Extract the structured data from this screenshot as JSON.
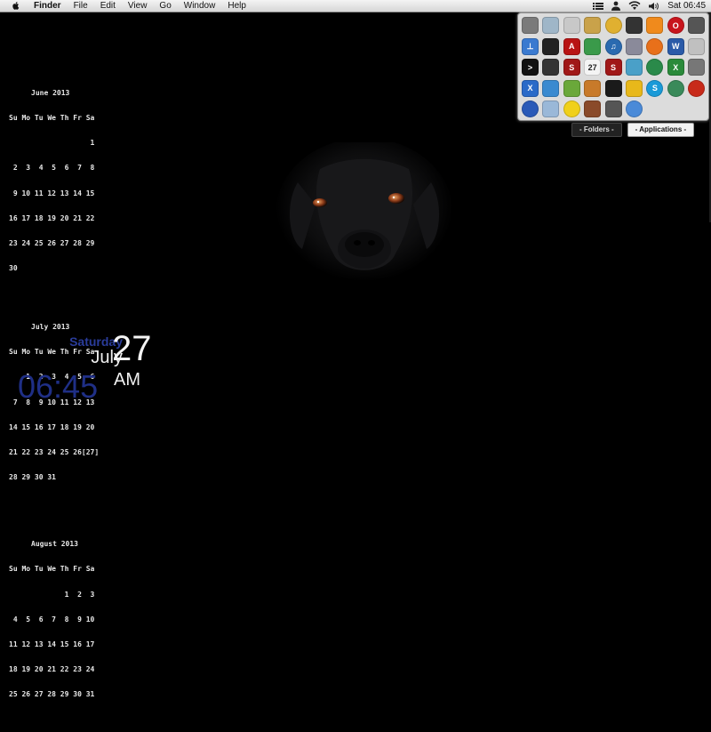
{
  "menubar": {
    "app_name": "Finder",
    "menus": [
      "File",
      "Edit",
      "View",
      "Go",
      "Window",
      "Help"
    ],
    "status_icons": [
      "list-icon",
      "user-icon",
      "wifi-icon",
      "volume-icon"
    ],
    "clock": "Sat 06:45"
  },
  "calendars": [
    {
      "title": "June 2013",
      "header": "Su Mo Tu We Th Fr Sa",
      "weeks": [
        "                   1",
        " 2  3  4  5  6  7  8",
        " 9 10 11 12 13 14 15",
        "16 17 18 19 20 21 22",
        "23 24 25 26 27 28 29",
        "30"
      ]
    },
    {
      "title": "July 2013",
      "header": "Su Mo Tu We Th Fr Sa",
      "weeks": [
        "    1  2  3  4  5  6",
        " 7  8  9 10 11 12 13",
        "14 15 16 17 18 19 20",
        "21 22 23 24 25 26[27]",
        "28 29 30 31"
      ]
    },
    {
      "title": "August 2013",
      "header": "Su Mo Tu We Th Fr Sa",
      "weeks": [
        "             1  2  3",
        " 4  5  6  7  8  9 10",
        "11 12 13 14 15 16 17",
        "18 19 20 21 22 23 24",
        "25 26 27 28 29 30 31"
      ]
    }
  ],
  "dateclock": {
    "weekday": "Saturday",
    "month": "July",
    "day": "27",
    "time": "06:45",
    "ampm": "AM"
  },
  "stack": {
    "tabs": {
      "folders": "- Folders -",
      "applications": "- Applications -"
    },
    "icons": [
      {
        "name": "utility-icon",
        "color": "#7a7a7a",
        "glyph": ""
      },
      {
        "name": "mail-icon",
        "color": "#9fb6c8",
        "glyph": ""
      },
      {
        "name": "archive-icon",
        "color": "#c8c8c8",
        "glyph": ""
      },
      {
        "name": "box-icon",
        "color": "#c9a24a",
        "glyph": ""
      },
      {
        "name": "chrome-icon",
        "color": "#e0b030",
        "glyph": ""
      },
      {
        "name": "camera-icon",
        "color": "#333333",
        "glyph": ""
      },
      {
        "name": "vlc-icon",
        "color": "#f08a1c",
        "glyph": ""
      },
      {
        "name": "opera-icon",
        "color": "#c8141c",
        "glyph": "O"
      },
      {
        "name": "clock-app-icon",
        "color": "#555555",
        "glyph": ""
      },
      {
        "name": "usb-icon",
        "color": "#3a7ad0",
        "glyph": "⊥"
      },
      {
        "name": "activity-icon",
        "color": "#222222",
        "glyph": ""
      },
      {
        "name": "acrobat-icon",
        "color": "#b81414",
        "glyph": "A"
      },
      {
        "name": "photos-icon",
        "color": "#3a9a4a",
        "glyph": ""
      },
      {
        "name": "itunes-icon",
        "color": "#2a6ab0",
        "glyph": "♫"
      },
      {
        "name": "utility2-icon",
        "color": "#8a8a9a",
        "glyph": ""
      },
      {
        "name": "firefox-icon",
        "color": "#e8701a",
        "glyph": ""
      },
      {
        "name": "word-icon",
        "color": "#2a5aa8",
        "glyph": "W"
      },
      {
        "name": "notes-icon",
        "color": "#c0c0c0",
        "glyph": ""
      },
      {
        "name": "terminal-icon",
        "color": "#111111",
        "glyph": ">"
      },
      {
        "name": "film-icon",
        "color": "#333333",
        "glyph": ""
      },
      {
        "name": "scrivener-icon",
        "color": "#a01818",
        "glyph": "S"
      },
      {
        "name": "calendar-icon",
        "color": "#f4f4f4",
        "glyph": "27"
      },
      {
        "name": "skim-icon",
        "color": "#a01818",
        "glyph": "S"
      },
      {
        "name": "fish-icon",
        "color": "#4aa0c8",
        "glyph": ""
      },
      {
        "name": "quicktime-icon",
        "color": "#2a8a4a",
        "glyph": ""
      },
      {
        "name": "excel-icon",
        "color": "#2a8a3a",
        "glyph": "X"
      },
      {
        "name": "screenshot-icon",
        "color": "#777777",
        "glyph": ""
      },
      {
        "name": "x-app-icon",
        "color": "#2a6ac8",
        "glyph": "X"
      },
      {
        "name": "network-icon",
        "color": "#3a8ad0",
        "glyph": ""
      },
      {
        "name": "crossover-icon",
        "color": "#6aa83a",
        "glyph": ""
      },
      {
        "name": "gallery-icon",
        "color": "#c87a2a",
        "glyph": ""
      },
      {
        "name": "kindle-icon",
        "color": "#1a1a1a",
        "glyph": ""
      },
      {
        "name": "radioactive-icon",
        "color": "#e8b81a",
        "glyph": ""
      },
      {
        "name": "skype-icon",
        "color": "#1a9ad8",
        "glyph": "S"
      },
      {
        "name": "time-machine-icon",
        "color": "#3a8a5a",
        "glyph": ""
      },
      {
        "name": "daisy-icon",
        "color": "#c82a1a",
        "glyph": ""
      },
      {
        "name": "world-icon",
        "color": "#2a5ab8",
        "glyph": ""
      },
      {
        "name": "finder-path-icon",
        "color": "#9ab8d8",
        "glyph": ""
      },
      {
        "name": "pacman-icon",
        "color": "#f0d01a",
        "glyph": ""
      },
      {
        "name": "library-icon",
        "color": "#8a4a2a",
        "glyph": ""
      },
      {
        "name": "photo-booth-icon",
        "color": "#555555",
        "glyph": ""
      },
      {
        "name": "safari-icon",
        "color": "#4a8ad8",
        "glyph": ""
      }
    ]
  }
}
